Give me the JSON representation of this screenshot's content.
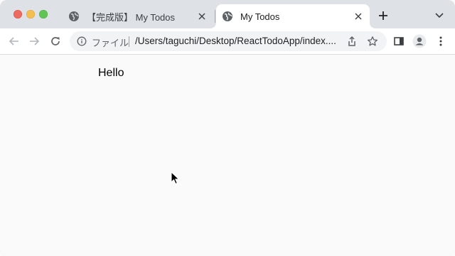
{
  "window": {
    "tabs": [
      {
        "title": "【完成版】 My Todos",
        "active": false
      },
      {
        "title": "My Todos",
        "active": true
      }
    ]
  },
  "toolbar": {
    "security_chip": "ファイル",
    "url": "/Users/taguchi/Desktop/ReactTodoApp/index...."
  },
  "page": {
    "body_text": "Hello"
  },
  "colors": {
    "tabstrip_bg": "#dee1e6",
    "active_tab_bg": "#ffffff",
    "omnibox_bg": "#f1f3f4",
    "page_bg": "#fafafa",
    "traffic_red": "#ed6a5e",
    "traffic_yellow": "#f5bf4f",
    "traffic_green": "#61c554"
  },
  "icons": {
    "tab_favicon": "globe-icon",
    "back": "arrow-left-icon",
    "forward": "arrow-right-icon",
    "reload": "reload-icon",
    "info": "info-icon",
    "share": "share-icon",
    "bookmark": "star-icon",
    "side_panel": "side-panel-icon",
    "profile": "profile-icon",
    "menu": "kebab-menu-icon",
    "new_tab": "plus-icon",
    "tab_search": "chevron-down-icon"
  }
}
